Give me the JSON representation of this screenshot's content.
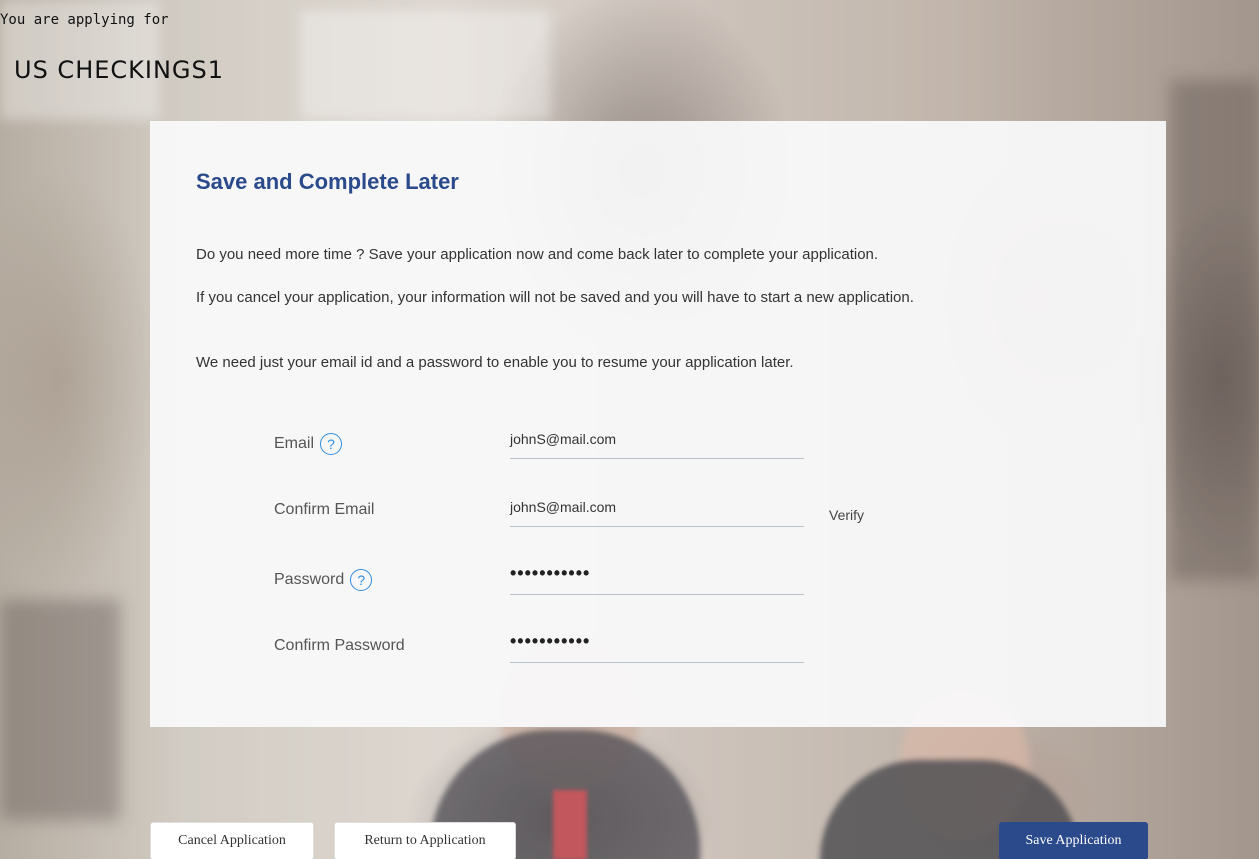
{
  "header": {
    "applying_label": "You are applying for",
    "product_name": "US CHECKINGS1"
  },
  "panel": {
    "title": "Save and Complete Later",
    "paragraph1": "Do you need more time ? Save your application now and come back later to complete your application.",
    "paragraph2": "If you cancel your application, your information will not be saved and you will have to start a new application.",
    "paragraph3": "We need just your email id and a password to enable you to resume your application later."
  },
  "form": {
    "email_label": "Email",
    "email_value": "johnS@mail.com",
    "confirm_email_label": "Confirm Email",
    "confirm_email_value": "johnS@mail.com",
    "verify_label": "Verify",
    "password_label": "Password",
    "password_value": "•••••••••••",
    "confirm_password_label": "Confirm Password",
    "confirm_password_value": "•••••••••••",
    "help_icon_glyph": "?"
  },
  "buttons": {
    "cancel": "Cancel Application",
    "return": "Return to Application",
    "save": "Save Application"
  },
  "colors": {
    "accent": "#2a4a8b",
    "help_icon": "#2f8ee0"
  }
}
